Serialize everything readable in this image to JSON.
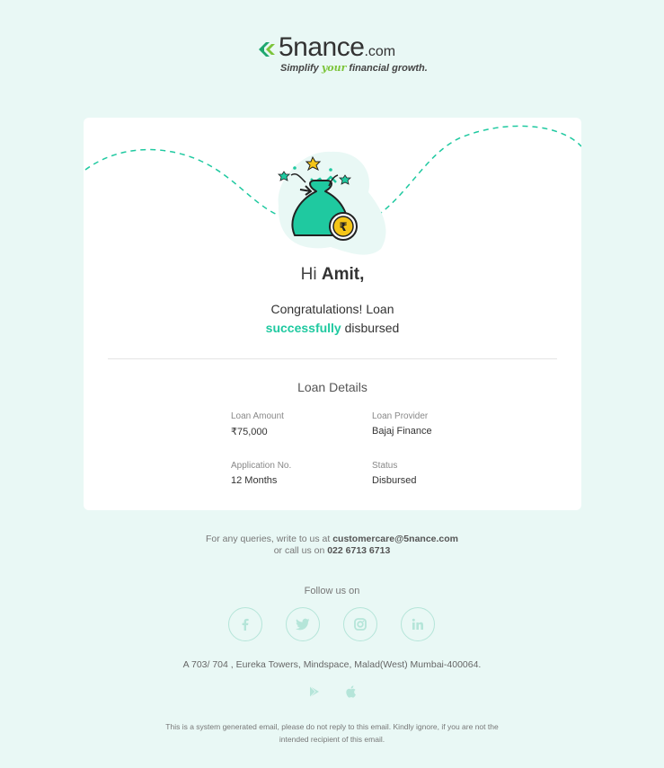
{
  "brand": {
    "name": "5nance",
    "tld": ".com",
    "tagline_pre": "Simplify ",
    "tagline_hl": "your",
    "tagline_post": " financial growth."
  },
  "card": {
    "greeting_prefix": "Hi ",
    "user_name": "Amit,",
    "message_line1": "Congratulations! Loan",
    "message_highlight": "successfully",
    "message_suffix": " disbursed",
    "section_title": "Loan Details",
    "details": [
      {
        "label": "Loan Amount",
        "value": "₹75,000"
      },
      {
        "label": "Loan Provider",
        "value": "Bajaj Finance"
      },
      {
        "label": "Application No.",
        "value": "12 Months"
      },
      {
        "label": "Status",
        "value": "Disbursed"
      }
    ]
  },
  "footer": {
    "query_pre": "For any queries, write to us at ",
    "email": "customercare@5nance.com",
    "call_pre": "or call us on ",
    "phone": "022 6713 6713",
    "follow_label": "Follow us on",
    "social": [
      "facebook-icon",
      "twitter-icon",
      "instagram-icon",
      "linkedin-icon"
    ],
    "address": "A 703/ 704 , Eureka Towers, Mindspace, Malad(West) Mumbai-400064.",
    "stores": [
      "google-play-icon",
      "apple-icon"
    ],
    "disclaimer_line1": "This is a system generated email, please do not reply to this email. Kindly ignore, if you are not the",
    "disclaimer_line2": "intended recipient of this email."
  },
  "colors": {
    "background": "#e9f8f5",
    "accent": "#1fc9a0",
    "brand_green": "#7cc43a",
    "coin": "#f5c518"
  }
}
